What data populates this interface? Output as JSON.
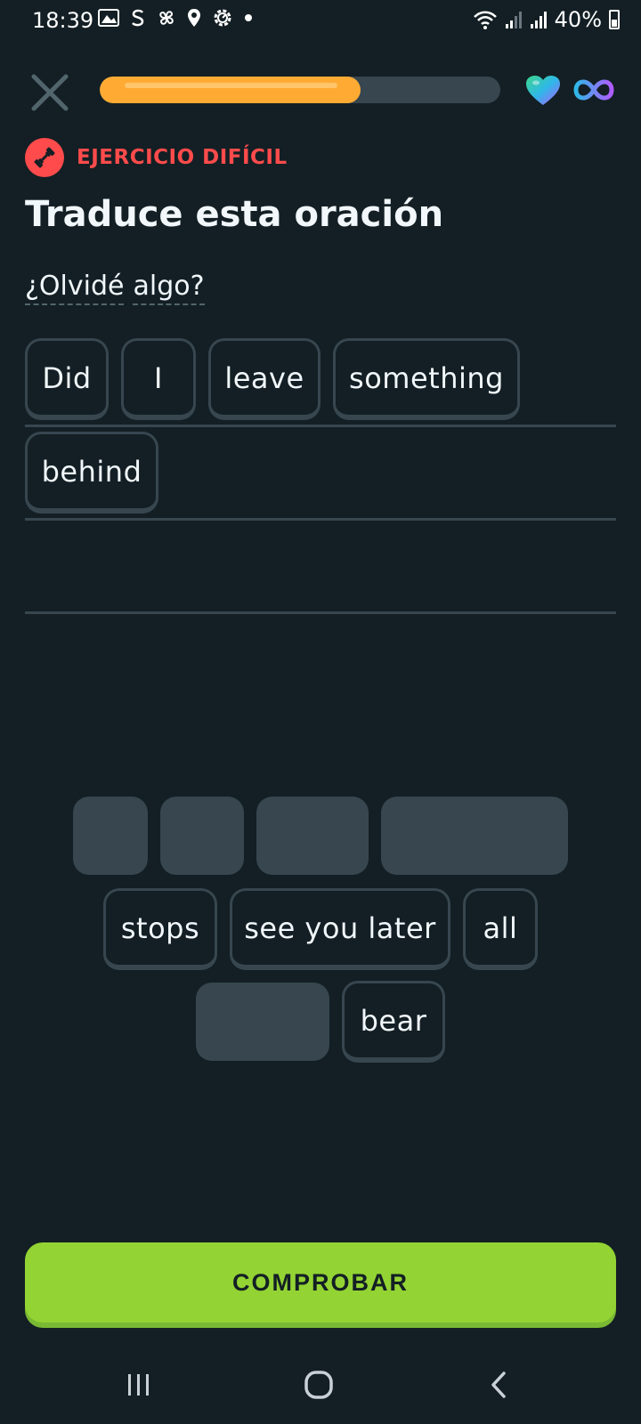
{
  "status_bar": {
    "time": "18:39",
    "battery": "40%",
    "left_icons": [
      "gallery-icon",
      "s-icon",
      "pinwheel-icon",
      "location-icon",
      "settings-icon",
      "dot-icon"
    ],
    "right_icons": [
      "wifi-icon",
      "signal-icon",
      "signal-icon",
      "battery-icon"
    ]
  },
  "header": {
    "progress_fraction": 0.65,
    "progress_color": "#ffab33",
    "hearts_icon": "heart-icon",
    "hearts_value_icon": "infinity-icon"
  },
  "badge": {
    "icon": "dumbbell-icon",
    "label": "EJERCICIO DIFÍCIL",
    "color": "#ff4b4b"
  },
  "title": "Traduce esta oración",
  "prompt": {
    "words": [
      "¿Olvidé",
      "algo?"
    ]
  },
  "answer": {
    "words": [
      "Did",
      "I",
      "leave",
      "something",
      "behind"
    ]
  },
  "word_bank": {
    "available": [
      "stops",
      "see you later",
      "all",
      "bear"
    ]
  },
  "check_button": {
    "label": "COMPROBAR",
    "color": "#93d333"
  },
  "nav": {
    "icons": [
      "recent-apps-icon",
      "home-icon",
      "back-icon"
    ]
  }
}
